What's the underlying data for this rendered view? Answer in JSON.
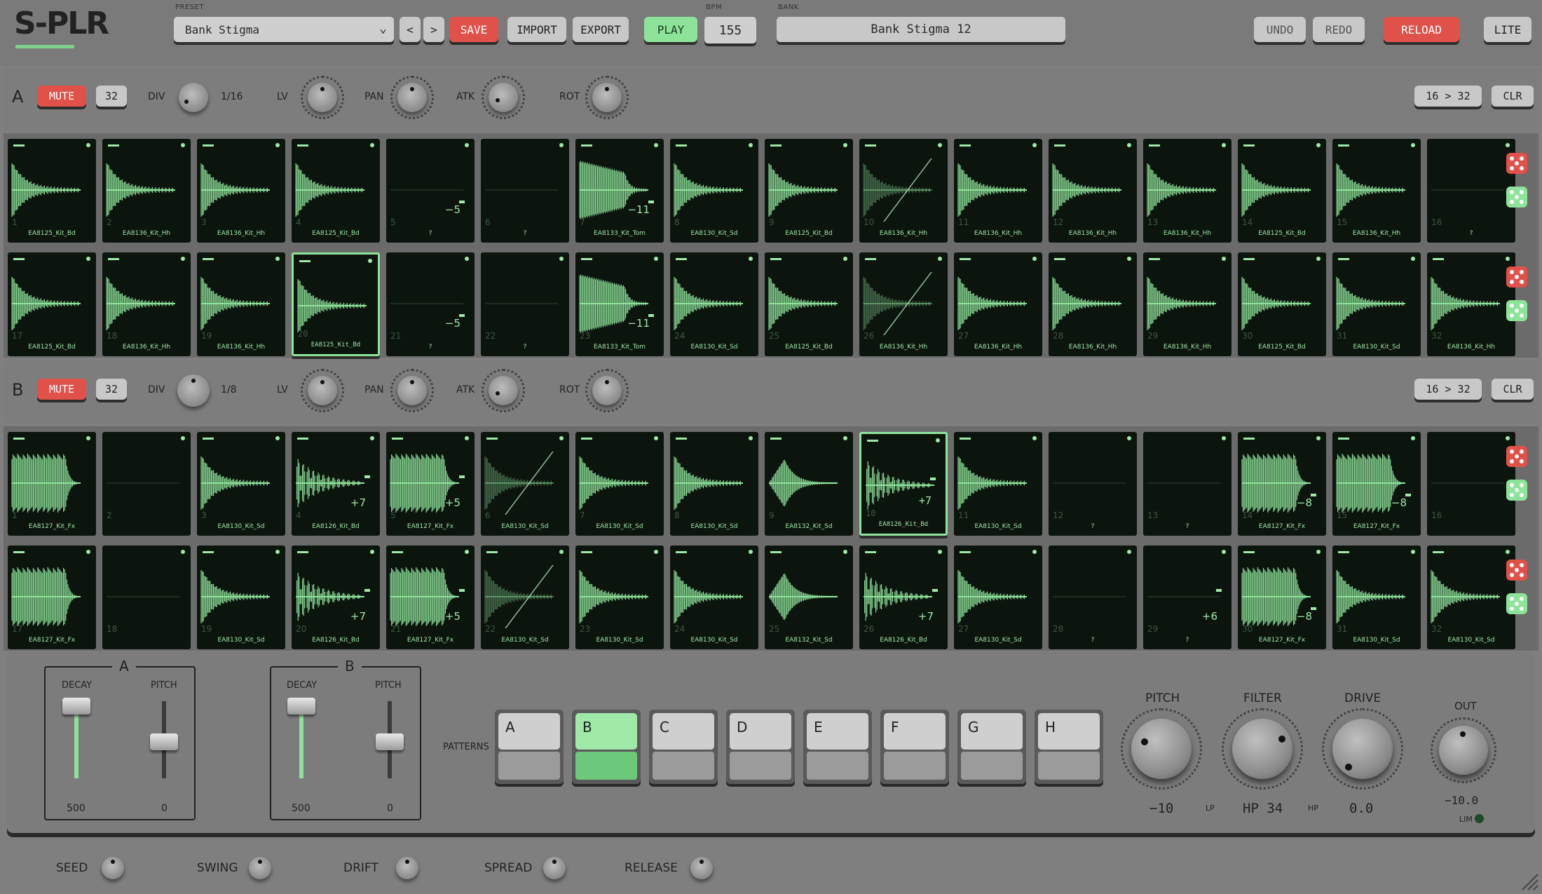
{
  "app": {
    "logo": "S-PLR"
  },
  "header": {
    "preset_label": "PRESET",
    "preset_value": "Bank Stigma",
    "prev": "<",
    "next": ">",
    "save": "SAVE",
    "import": "IMPORT",
    "export": "EXPORT",
    "play": "PLAY",
    "bpm_label": "BPM",
    "bpm": "155",
    "bank_label": "BANK",
    "bank_value": "Bank Stigma  12",
    "undo": "UNDO",
    "redo": "REDO",
    "reload": "RELOAD",
    "lite": "LITE"
  },
  "tracks": [
    {
      "id": "A",
      "mute": "MUTE",
      "steps": "32",
      "div_label": "DIV",
      "div": "1/16",
      "lv": "LV",
      "pan": "PAN",
      "atk": "ATK",
      "rot": "ROT",
      "expand": "16 > 32",
      "clear": "CLR"
    },
    {
      "id": "B",
      "mute": "MUTE",
      "steps": "32",
      "div_label": "DIV",
      "div": "1/8",
      "lv": "LV",
      "pan": "PAN",
      "atk": "ATK",
      "rot": "ROT",
      "expand": "16 > 32",
      "clear": "CLR"
    }
  ],
  "trackA_cells": [
    {
      "n": "1",
      "name": "EA8125_Kit_Bd",
      "w": "kick"
    },
    {
      "n": "2",
      "name": "EA8136_Kit_Hh",
      "w": "kick"
    },
    {
      "n": "3",
      "name": "EA8136_Kit_Hh",
      "w": "kick"
    },
    {
      "n": "4",
      "name": "EA8125_Kit_Bd",
      "w": "kick"
    },
    {
      "n": "5",
      "name": "?",
      "w": "flat",
      "val": "−5"
    },
    {
      "n": "6",
      "name": "?",
      "w": "flat"
    },
    {
      "n": "7",
      "name": "EA8133_Kit_Tom",
      "w": "tom",
      "val": "−11"
    },
    {
      "n": "8",
      "name": "EA8130_Kit_Sd",
      "w": "kick"
    },
    {
      "n": "9",
      "name": "EA8125_Kit_Bd",
      "w": "kick"
    },
    {
      "n": "10",
      "name": "EA8136_Kit_Hh",
      "w": "kick",
      "slash": true
    },
    {
      "n": "11",
      "name": "EA8136_Kit_Hh",
      "w": "kick"
    },
    {
      "n": "12",
      "name": "EA8136_Kit_Hh",
      "w": "kick"
    },
    {
      "n": "13",
      "name": "EA8136_Kit_Hh",
      "w": "kick"
    },
    {
      "n": "14",
      "name": "EA8125_Kit_Bd",
      "w": "kick"
    },
    {
      "n": "15",
      "name": "EA8136_Kit_Hh",
      "w": "kick"
    },
    {
      "n": "16",
      "name": "?",
      "w": "flat"
    },
    {
      "n": "17",
      "name": "EA8125_Kit_Bd",
      "w": "kick"
    },
    {
      "n": "18",
      "name": "EA8136_Kit_Hh",
      "w": "kick"
    },
    {
      "n": "19",
      "name": "EA8136_Kit_Hh",
      "w": "kick"
    },
    {
      "n": "20",
      "name": "EA8125_Kit_Bd",
      "w": "kick",
      "sel": true
    },
    {
      "n": "21",
      "name": "?",
      "w": "flat",
      "val": "−5"
    },
    {
      "n": "22",
      "name": "?",
      "w": "flat"
    },
    {
      "n": "23",
      "name": "EA8133_Kit_Tom",
      "w": "tom",
      "val": "−11"
    },
    {
      "n": "24",
      "name": "EA8130_Kit_Sd",
      "w": "kick"
    },
    {
      "n": "25",
      "name": "EA8125_Kit_Bd",
      "w": "kick"
    },
    {
      "n": "26",
      "name": "EA8136_Kit_Hh",
      "w": "kick",
      "slash": true
    },
    {
      "n": "27",
      "name": "EA8136_Kit_Hh",
      "w": "kick"
    },
    {
      "n": "28",
      "name": "EA8136_Kit_Hh",
      "w": "kick"
    },
    {
      "n": "29",
      "name": "EA8136_Kit_Hh",
      "w": "kick"
    },
    {
      "n": "30",
      "name": "EA8125_Kit_Bd",
      "w": "kick"
    },
    {
      "n": "31",
      "name": "EA8130_Kit_Sd",
      "w": "kick"
    },
    {
      "n": "32",
      "name": "EA8136_Kit_Hh",
      "w": "kick"
    }
  ],
  "trackB_cells": [
    {
      "n": "1",
      "name": "EA8127_Kit_Fx",
      "w": "noise"
    },
    {
      "n": "2",
      "name": "",
      "w": "flat"
    },
    {
      "n": "3",
      "name": "EA8130_Kit_Sd",
      "w": "kick"
    },
    {
      "n": "4",
      "name": "EA8126_Kit_Bd",
      "w": "burst",
      "val": "+7"
    },
    {
      "n": "5",
      "name": "EA8127_Kit_Fx",
      "w": "noise",
      "val": "+5"
    },
    {
      "n": "6",
      "name": "EA8130_Kit_Sd",
      "w": "kick",
      "slash": true
    },
    {
      "n": "7",
      "name": "EA8130_Kit_Sd",
      "w": "kick"
    },
    {
      "n": "8",
      "name": "EA8130_Kit_Sd",
      "w": "kick"
    },
    {
      "n": "9",
      "name": "EA8132_Kit_Sd",
      "w": "diamond"
    },
    {
      "n": "10",
      "name": "EA8126_Kit_Bd",
      "w": "burst",
      "val": "+7",
      "sel": true
    },
    {
      "n": "11",
      "name": "EA8130_Kit_Sd",
      "w": "kick"
    },
    {
      "n": "12",
      "name": "?",
      "w": "flat"
    },
    {
      "n": "13",
      "name": "?",
      "w": "flat"
    },
    {
      "n": "14",
      "name": "EA8127_Kit_Fx",
      "w": "noise",
      "val": "−8"
    },
    {
      "n": "15",
      "name": "EA8127_Kit_Fx",
      "w": "noise",
      "val": "−8"
    },
    {
      "n": "16",
      "name": "",
      "w": "flat"
    },
    {
      "n": "17",
      "name": "EA8127_Kit_Fx",
      "w": "noise"
    },
    {
      "n": "18",
      "name": "",
      "w": "flat"
    },
    {
      "n": "19",
      "name": "EA8130_Kit_Sd",
      "w": "kick"
    },
    {
      "n": "20",
      "name": "EA8126_Kit_Bd",
      "w": "burst",
      "val": "+7"
    },
    {
      "n": "21",
      "name": "EA8127_Kit_Fx",
      "w": "noise",
      "val": "+5"
    },
    {
      "n": "22",
      "name": "EA8130_Kit_Sd",
      "w": "kick",
      "slash": true
    },
    {
      "n": "23",
      "name": "EA8130_Kit_Sd",
      "w": "kick"
    },
    {
      "n": "24",
      "name": "EA8130_Kit_Sd",
      "w": "kick"
    },
    {
      "n": "25",
      "name": "EA8132_Kit_Sd",
      "w": "diamond"
    },
    {
      "n": "26",
      "name": "EA8126_Kit_Bd",
      "w": "burst",
      "val": "+7"
    },
    {
      "n": "27",
      "name": "EA8130_Kit_Sd",
      "w": "kick"
    },
    {
      "n": "28",
      "name": "?",
      "w": "flat"
    },
    {
      "n": "29",
      "name": "?",
      "w": "flat",
      "val": "+6"
    },
    {
      "n": "30",
      "name": "EA8127_Kit_Fx",
      "w": "noise",
      "val": "−8"
    },
    {
      "n": "31",
      "name": "EA8130_Kit_Sd",
      "w": "kick"
    },
    {
      "n": "32",
      "name": "EA8130_Kit_Sd",
      "w": "kick"
    }
  ],
  "envelopes": [
    {
      "title": "A",
      "decay_label": "DECAY",
      "pitch_label": "PITCH",
      "decay": "500",
      "pitch": "0"
    },
    {
      "title": "B",
      "decay_label": "DECAY",
      "pitch_label": "PITCH",
      "decay": "500",
      "pitch": "0"
    }
  ],
  "patterns": {
    "label": "PATTERNS",
    "items": [
      "A",
      "B",
      "C",
      "D",
      "E",
      "F",
      "G",
      "H"
    ],
    "active": "B"
  },
  "master": {
    "pitch_label": "PITCH",
    "pitch": "−10",
    "lp": "LP",
    "filter_label": "FILTER",
    "filter": "HP 34",
    "hp": "HP",
    "drive_label": "DRIVE",
    "drive": "0.0",
    "out_label": "OUT",
    "out": "−10.0",
    "lim": "LIM"
  },
  "footer": {
    "seed": "SEED",
    "swing": "SWING",
    "drift": "DRIFT",
    "spread": "SPREAD",
    "release": "RELEASE"
  },
  "colors": {
    "accent": "#8ee39a",
    "red": "#e0514a",
    "cell_bg": "#0c140e"
  }
}
